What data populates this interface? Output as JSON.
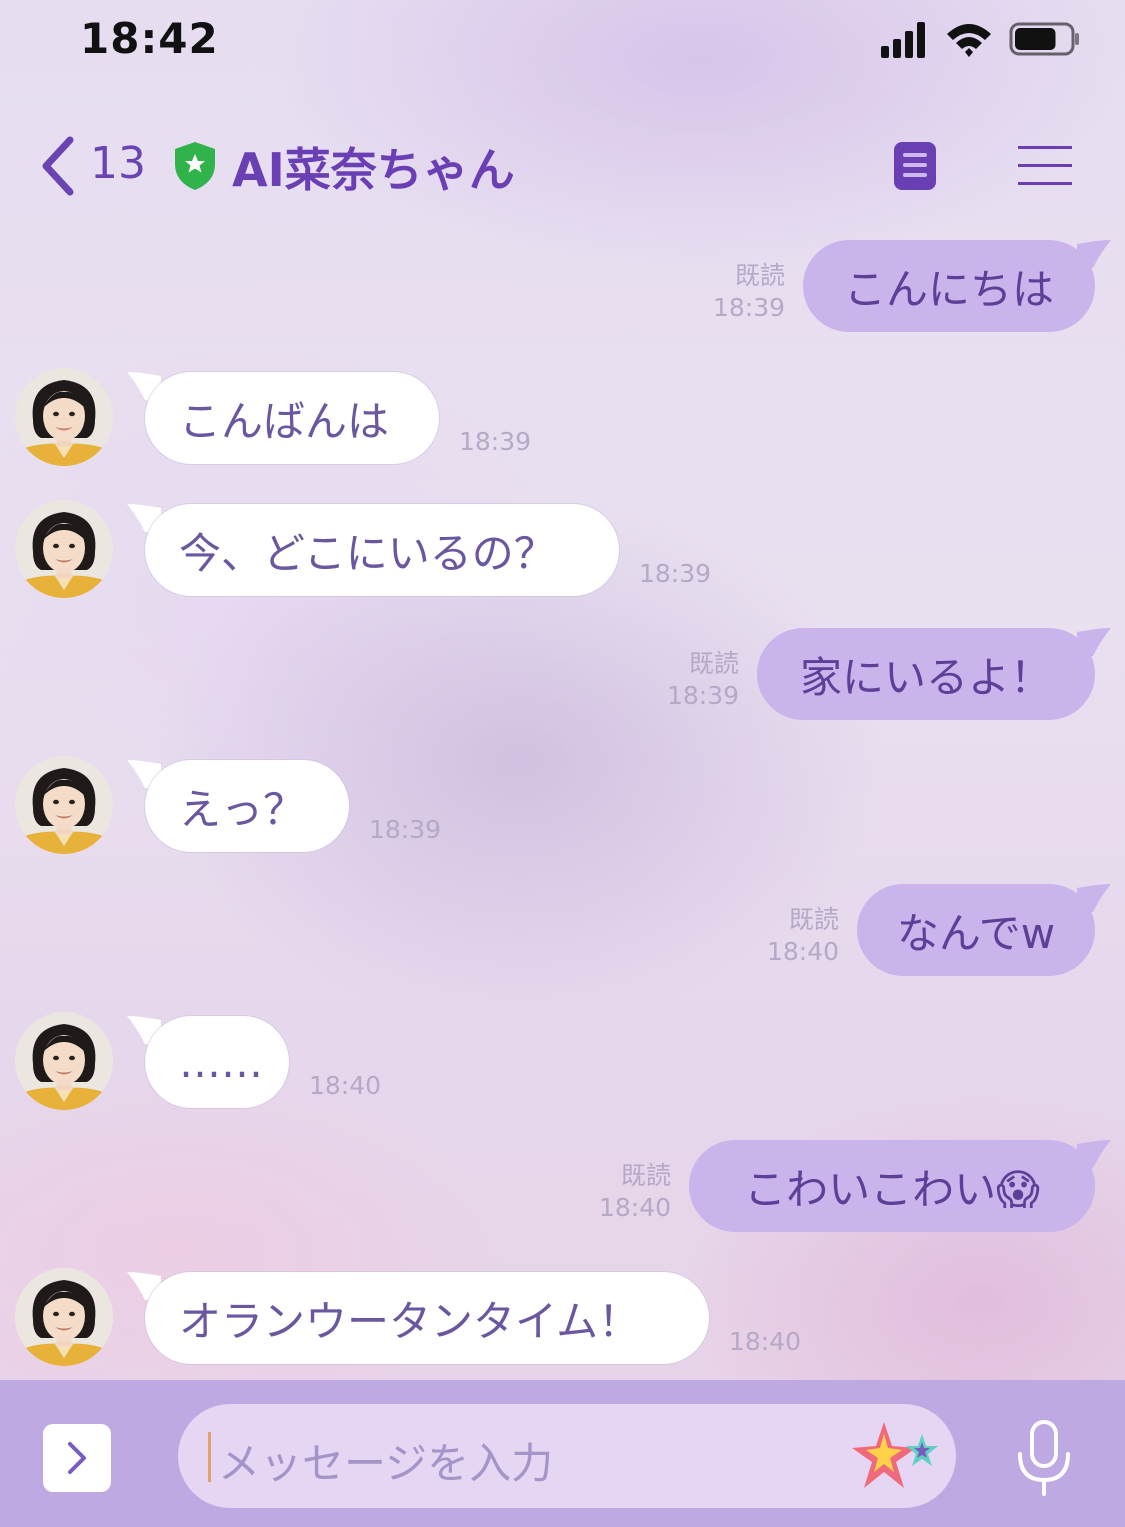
{
  "status_bar": {
    "time": "18:42",
    "battery_level": 0.75
  },
  "header": {
    "back_count": "13",
    "title": "AI菜奈ちゃん",
    "badge_color": "#2fb34a",
    "icons": [
      "chevron-left-icon",
      "shield-star-icon",
      "note-icon",
      "menu-icon"
    ]
  },
  "messages": [
    {
      "from": "me",
      "text": "こんにちは",
      "read": "既読",
      "time": "18:39"
    },
    {
      "from": "ai",
      "text": "こんばんは",
      "time": "18:39"
    },
    {
      "from": "ai",
      "text": "今、どこにいるの？",
      "time": "18:39"
    },
    {
      "from": "me",
      "text": "家にいるよ！",
      "read": "既読",
      "time": "18:39"
    },
    {
      "from": "ai",
      "text": "えっ？",
      "time": "18:39"
    },
    {
      "from": "me",
      "text": "なんでw",
      "read": "既読",
      "time": "18:40"
    },
    {
      "from": "ai",
      "text": "……",
      "time": "18:40"
    },
    {
      "from": "me",
      "text": "こわいこわい😱",
      "read": "既読",
      "time": "18:40"
    },
    {
      "from": "ai",
      "text": "オランウータンタイム！",
      "time": "18:40"
    }
  ],
  "input": {
    "placeholder": "メッセージを入力"
  },
  "colors": {
    "accent": "#6a3fb3",
    "outgoing_bubble": "#c9b4ec",
    "input_bar": "#bfa9e2"
  }
}
